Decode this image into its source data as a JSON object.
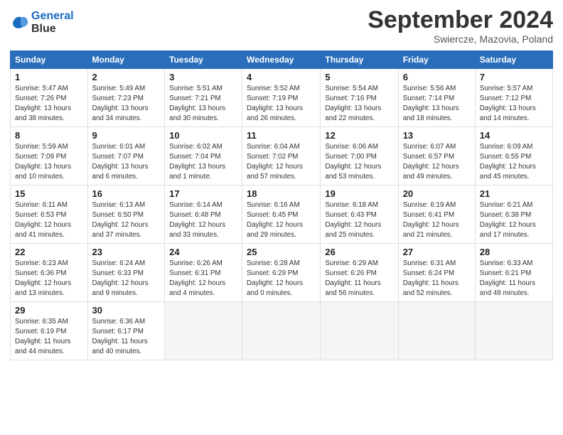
{
  "header": {
    "logo_line1": "General",
    "logo_line2": "Blue",
    "month": "September 2024",
    "location": "Swiercze, Mazovia, Poland"
  },
  "weekdays": [
    "Sunday",
    "Monday",
    "Tuesday",
    "Wednesday",
    "Thursday",
    "Friday",
    "Saturday"
  ],
  "weeks": [
    [
      {
        "day": "1",
        "detail": "Sunrise: 5:47 AM\nSunset: 7:26 PM\nDaylight: 13 hours\nand 38 minutes."
      },
      {
        "day": "2",
        "detail": "Sunrise: 5:49 AM\nSunset: 7:23 PM\nDaylight: 13 hours\nand 34 minutes."
      },
      {
        "day": "3",
        "detail": "Sunrise: 5:51 AM\nSunset: 7:21 PM\nDaylight: 13 hours\nand 30 minutes."
      },
      {
        "day": "4",
        "detail": "Sunrise: 5:52 AM\nSunset: 7:19 PM\nDaylight: 13 hours\nand 26 minutes."
      },
      {
        "day": "5",
        "detail": "Sunrise: 5:54 AM\nSunset: 7:16 PM\nDaylight: 13 hours\nand 22 minutes."
      },
      {
        "day": "6",
        "detail": "Sunrise: 5:56 AM\nSunset: 7:14 PM\nDaylight: 13 hours\nand 18 minutes."
      },
      {
        "day": "7",
        "detail": "Sunrise: 5:57 AM\nSunset: 7:12 PM\nDaylight: 13 hours\nand 14 minutes."
      }
    ],
    [
      {
        "day": "8",
        "detail": "Sunrise: 5:59 AM\nSunset: 7:09 PM\nDaylight: 13 hours\nand 10 minutes."
      },
      {
        "day": "9",
        "detail": "Sunrise: 6:01 AM\nSunset: 7:07 PM\nDaylight: 13 hours\nand 6 minutes."
      },
      {
        "day": "10",
        "detail": "Sunrise: 6:02 AM\nSunset: 7:04 PM\nDaylight: 13 hours\nand 1 minute."
      },
      {
        "day": "11",
        "detail": "Sunrise: 6:04 AM\nSunset: 7:02 PM\nDaylight: 12 hours\nand 57 minutes."
      },
      {
        "day": "12",
        "detail": "Sunrise: 6:06 AM\nSunset: 7:00 PM\nDaylight: 12 hours\nand 53 minutes."
      },
      {
        "day": "13",
        "detail": "Sunrise: 6:07 AM\nSunset: 6:57 PM\nDaylight: 12 hours\nand 49 minutes."
      },
      {
        "day": "14",
        "detail": "Sunrise: 6:09 AM\nSunset: 6:55 PM\nDaylight: 12 hours\nand 45 minutes."
      }
    ],
    [
      {
        "day": "15",
        "detail": "Sunrise: 6:11 AM\nSunset: 6:53 PM\nDaylight: 12 hours\nand 41 minutes."
      },
      {
        "day": "16",
        "detail": "Sunrise: 6:13 AM\nSunset: 6:50 PM\nDaylight: 12 hours\nand 37 minutes."
      },
      {
        "day": "17",
        "detail": "Sunrise: 6:14 AM\nSunset: 6:48 PM\nDaylight: 12 hours\nand 33 minutes."
      },
      {
        "day": "18",
        "detail": "Sunrise: 6:16 AM\nSunset: 6:45 PM\nDaylight: 12 hours\nand 29 minutes."
      },
      {
        "day": "19",
        "detail": "Sunrise: 6:18 AM\nSunset: 6:43 PM\nDaylight: 12 hours\nand 25 minutes."
      },
      {
        "day": "20",
        "detail": "Sunrise: 6:19 AM\nSunset: 6:41 PM\nDaylight: 12 hours\nand 21 minutes."
      },
      {
        "day": "21",
        "detail": "Sunrise: 6:21 AM\nSunset: 6:38 PM\nDaylight: 12 hours\nand 17 minutes."
      }
    ],
    [
      {
        "day": "22",
        "detail": "Sunrise: 6:23 AM\nSunset: 6:36 PM\nDaylight: 12 hours\nand 13 minutes."
      },
      {
        "day": "23",
        "detail": "Sunrise: 6:24 AM\nSunset: 6:33 PM\nDaylight: 12 hours\nand 9 minutes."
      },
      {
        "day": "24",
        "detail": "Sunrise: 6:26 AM\nSunset: 6:31 PM\nDaylight: 12 hours\nand 4 minutes."
      },
      {
        "day": "25",
        "detail": "Sunrise: 6:28 AM\nSunset: 6:29 PM\nDaylight: 12 hours\nand 0 minutes."
      },
      {
        "day": "26",
        "detail": "Sunrise: 6:29 AM\nSunset: 6:26 PM\nDaylight: 11 hours\nand 56 minutes."
      },
      {
        "day": "27",
        "detail": "Sunrise: 6:31 AM\nSunset: 6:24 PM\nDaylight: 11 hours\nand 52 minutes."
      },
      {
        "day": "28",
        "detail": "Sunrise: 6:33 AM\nSunset: 6:21 PM\nDaylight: 11 hours\nand 48 minutes."
      }
    ],
    [
      {
        "day": "29",
        "detail": "Sunrise: 6:35 AM\nSunset: 6:19 PM\nDaylight: 11 hours\nand 44 minutes."
      },
      {
        "day": "30",
        "detail": "Sunrise: 6:36 AM\nSunset: 6:17 PM\nDaylight: 11 hours\nand 40 minutes."
      },
      null,
      null,
      null,
      null,
      null
    ]
  ]
}
